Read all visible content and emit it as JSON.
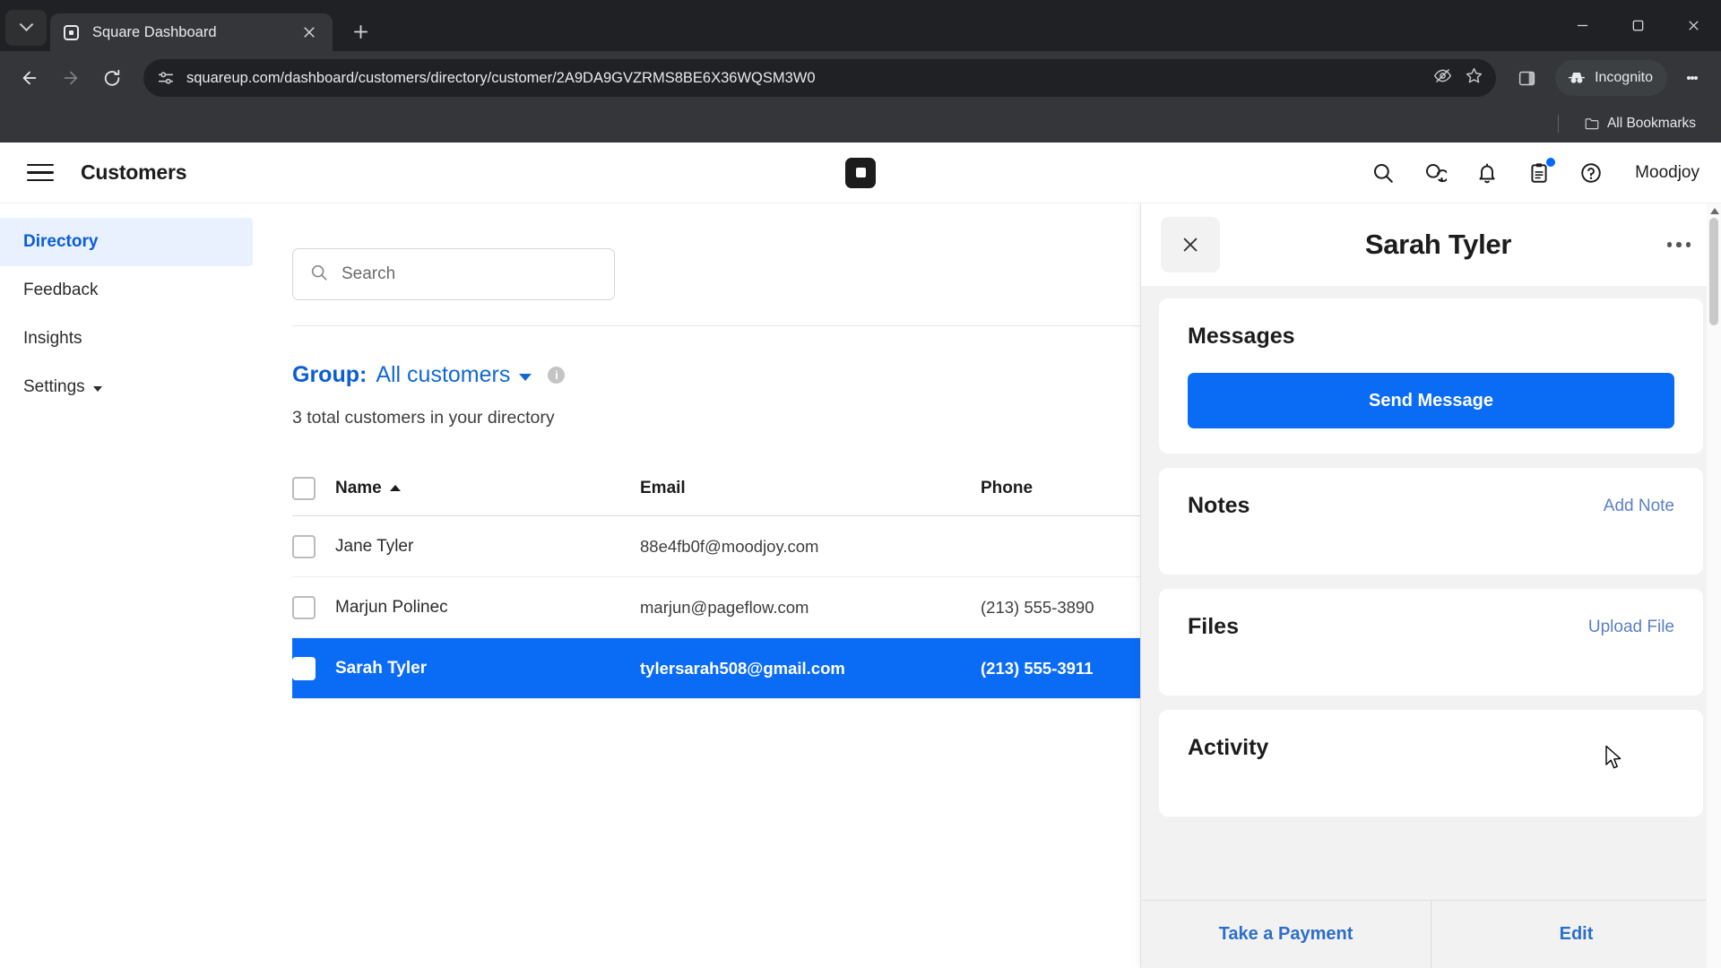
{
  "browser": {
    "tab": {
      "title": "Square Dashboard",
      "favicon": "square-favicon"
    },
    "url": "squareup.com/dashboard/customers/directory/customer/2A9DA9GVZRMS8BE6X36WQSM3W0",
    "incognito_label": "Incognito",
    "bookmarks_label": "All Bookmarks",
    "new_tab_tooltip": "New Tab"
  },
  "appbar": {
    "title": "Customers",
    "user": "Moodjoy",
    "icons": [
      "search-icon",
      "chat-icon",
      "bell-icon",
      "clipboard-icon",
      "help-icon"
    ]
  },
  "sidebar": {
    "items": [
      {
        "label": "Directory",
        "active": true
      },
      {
        "label": "Feedback",
        "active": false
      },
      {
        "label": "Insights",
        "active": false
      },
      {
        "label": "Settings",
        "active": false,
        "has_chevron": true
      }
    ]
  },
  "main": {
    "search_placeholder": "Search",
    "group_label": "Group:",
    "group_value": "All customers",
    "total_text": "3 total customers in your directory",
    "columns": [
      "Name",
      "Email",
      "Phone"
    ],
    "sort_column": "Name",
    "rows": [
      {
        "name": "Jane Tyler",
        "email": "88e4fb0f@moodjoy.com",
        "phone": "",
        "selected": false
      },
      {
        "name": "Marjun Polinec",
        "email": "marjun@pageflow.com",
        "phone": "(213) 555-3890",
        "selected": false
      },
      {
        "name": "Sarah Tyler",
        "email": "tylersarah508@gmail.com",
        "phone": "(213) 555-3911",
        "selected": true
      }
    ]
  },
  "drawer": {
    "title": "Sarah Tyler",
    "messages": {
      "title": "Messages",
      "button": "Send Message"
    },
    "notes": {
      "title": "Notes",
      "link": "Add Note"
    },
    "files": {
      "title": "Files",
      "link": "Upload File"
    },
    "activity": {
      "title": "Activity"
    },
    "footer": {
      "primary": "Take a Payment",
      "secondary": "Edit"
    }
  },
  "colors": {
    "accent_blue": "#0a6bf5",
    "link_blue": "#2c6ecb",
    "sidebar_active_bg": "#e9f1fe",
    "chrome_dark": "#202124",
    "toolbar_dark": "#35363a"
  }
}
